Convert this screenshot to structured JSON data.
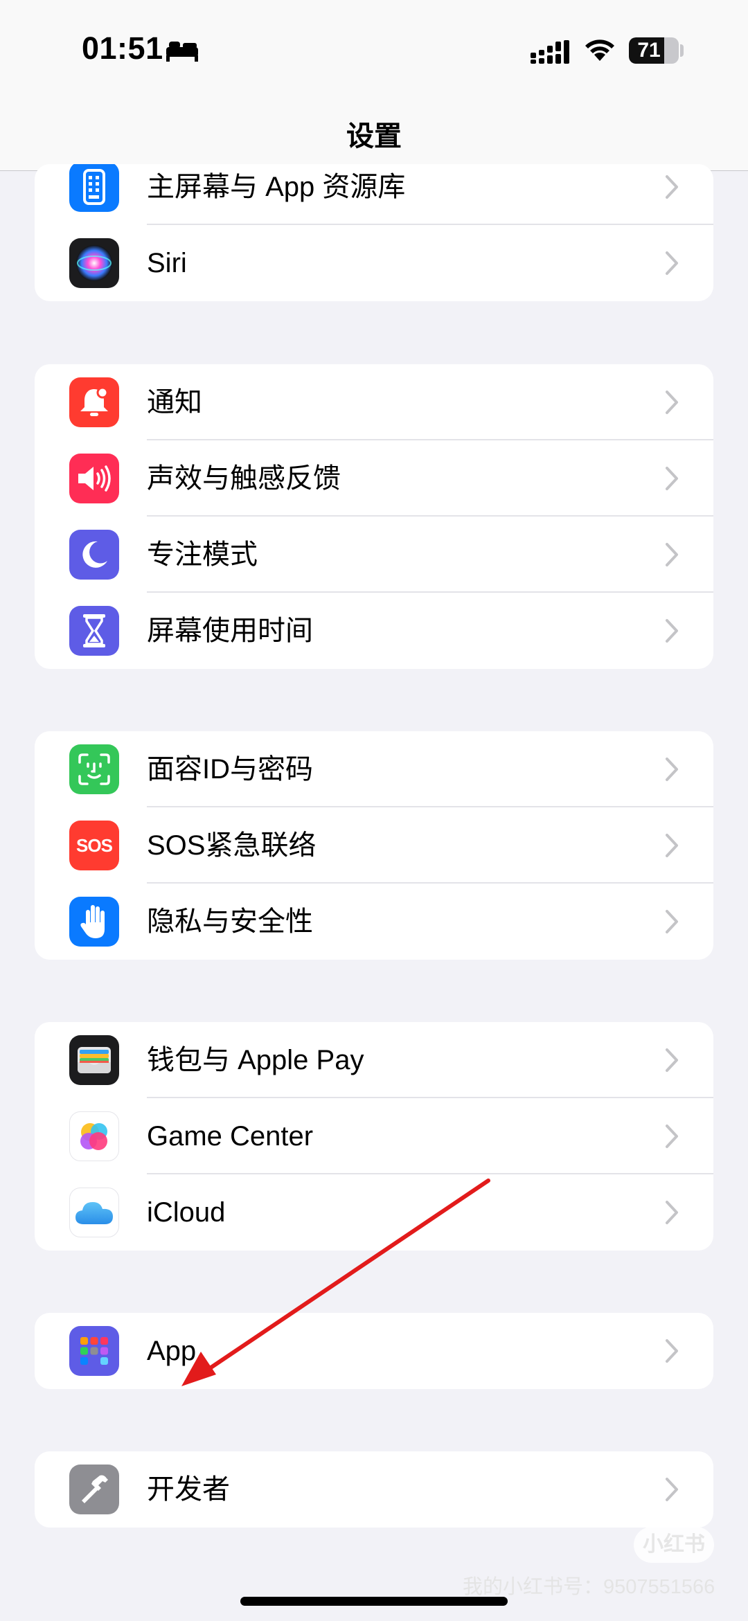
{
  "status_bar": {
    "time": "01:51",
    "battery_level": "71",
    "battery_fraction": 0.71
  },
  "nav": {
    "title": "设置"
  },
  "groups": [
    {
      "items": [
        {
          "label": "主屏幕与 App 资源库",
          "icon": "home-screen-icon",
          "color": "#0a7aff"
        },
        {
          "label": "Siri",
          "icon": "siri-icon",
          "color": "#1c1c1e"
        }
      ]
    },
    {
      "items": [
        {
          "label": "通知",
          "icon": "notification-bell-icon",
          "color": "#ff3b30"
        },
        {
          "label": "声效与触感反馈",
          "icon": "speaker-icon",
          "color": "#ff2d55"
        },
        {
          "label": "专注模式",
          "icon": "moon-icon",
          "color": "#5e5ce6"
        },
        {
          "label": "屏幕使用时间",
          "icon": "hourglass-icon",
          "color": "#5e5ce6"
        }
      ]
    },
    {
      "items": [
        {
          "label": "面容ID与密码",
          "icon": "face-id-icon",
          "color": "#34c759"
        },
        {
          "label": "SOS紧急联络",
          "icon": "sos-icon",
          "color": "#ff3b30",
          "icon_text": "SOS"
        },
        {
          "label": "隐私与安全性",
          "icon": "hand-icon",
          "color": "#0a7aff"
        }
      ]
    },
    {
      "items": [
        {
          "label": "钱包与 Apple Pay",
          "icon": "wallet-icon",
          "color": "#1c1c1e"
        },
        {
          "label": "Game Center",
          "icon": "game-center-icon",
          "color": "#ffffff"
        },
        {
          "label": "iCloud",
          "icon": "icloud-icon",
          "color": "#ffffff"
        }
      ]
    },
    {
      "items": [
        {
          "label": "App",
          "icon": "apps-grid-icon",
          "color": "#5e5ce6"
        }
      ]
    },
    {
      "items": [
        {
          "label": "开发者",
          "icon": "hammer-icon",
          "color": "#8e8e93"
        }
      ]
    }
  ],
  "watermark": {
    "badge": "小红书",
    "text": "我的小红书号：9507551566"
  },
  "annotation": {
    "color": "#e21b1b"
  }
}
